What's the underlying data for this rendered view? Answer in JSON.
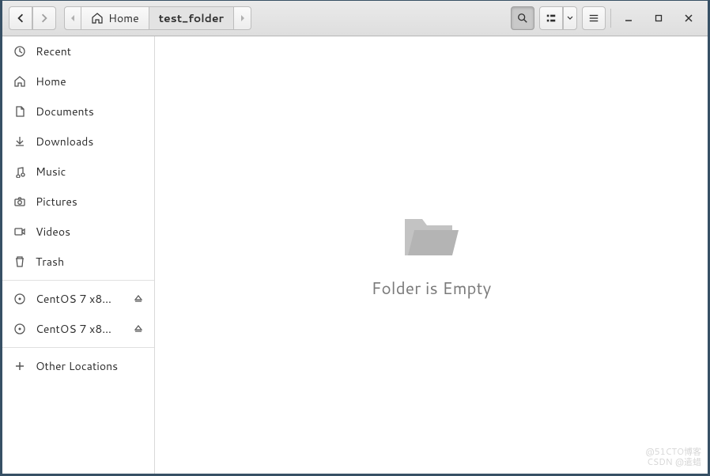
{
  "toolbar": {
    "nav": {
      "back_tooltip": "Back",
      "forward_tooltip": "Forward"
    },
    "pathbar": {
      "home_label": "Home",
      "current_label": "test_folder"
    },
    "right": {
      "search_tooltip": "Search",
      "view_toggle_tooltip": "List view",
      "menu_tooltip": "Menu",
      "minimize_tooltip": "Minimize",
      "maximize_tooltip": "Maximize",
      "close_tooltip": "Close"
    }
  },
  "sidebar": {
    "items": [
      {
        "icon": "clock-icon",
        "label": "Recent"
      },
      {
        "icon": "home-icon",
        "label": "Home"
      },
      {
        "icon": "document-icon",
        "label": "Documents"
      },
      {
        "icon": "download-icon",
        "label": "Downloads"
      },
      {
        "icon": "music-icon",
        "label": "Music"
      },
      {
        "icon": "camera-icon",
        "label": "Pictures"
      },
      {
        "icon": "video-icon",
        "label": "Videos"
      },
      {
        "icon": "trash-icon",
        "label": "Trash"
      }
    ],
    "mounts": [
      {
        "icon": "disc-icon",
        "label": "CentOS 7 x8…",
        "ejectable": true
      },
      {
        "icon": "disc-icon",
        "label": "CentOS 7 x8…",
        "ejectable": true
      }
    ],
    "other": {
      "icon": "plus-icon",
      "label": "Other Locations"
    }
  },
  "content": {
    "empty_text": "Folder is Empty"
  },
  "watermark": {
    "line1": "@51CTO博客",
    "line2": "CSDN @遣蜡"
  }
}
